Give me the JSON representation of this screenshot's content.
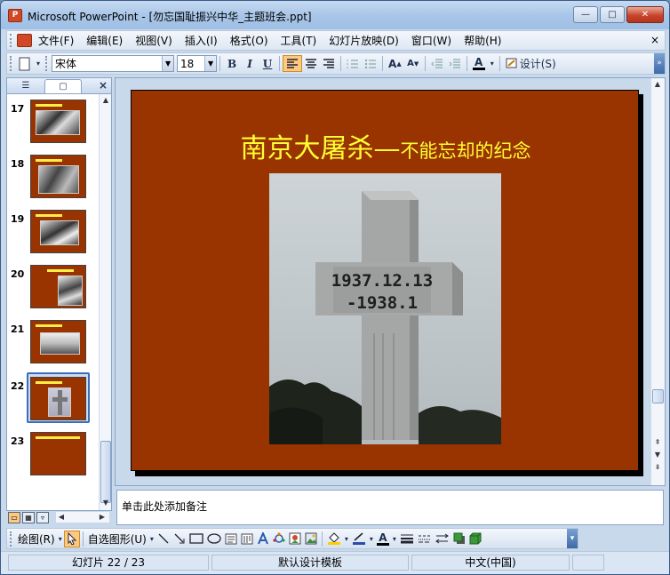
{
  "window": {
    "title": "Microsoft PowerPoint - [勿忘国耻振兴中华_主题班会.ppt]",
    "app_icon": "P",
    "minimize": "—",
    "maximize": "□",
    "close": "✕"
  },
  "menu": {
    "items": [
      "文件(F)",
      "编辑(E)",
      "视图(V)",
      "插入(I)",
      "格式(O)",
      "工具(T)",
      "幻灯片放映(D)",
      "窗口(W)",
      "帮助(H)"
    ],
    "close": "×"
  },
  "toolbar": {
    "font_name": "宋体",
    "font_size": "18",
    "bold": "B",
    "italic": "I",
    "underline": "U",
    "design_label": "设计(S)",
    "font_color_label": "A",
    "grow_font": "A",
    "shrink_font": "A",
    "more": "»"
  },
  "left_pane": {
    "tab_outline": "☰",
    "tab_slides": "▢",
    "close": "×",
    "slides": [
      {
        "num": "17",
        "title_color": "#ffee44",
        "image": "crowd-photo"
      },
      {
        "num": "18",
        "title_color": "#ffee44",
        "image": "crowd-photo"
      },
      {
        "num": "19",
        "title_color": "#ffee44",
        "image": "crowd-photo"
      },
      {
        "num": "20",
        "title_color": "#ffee44",
        "image": "crowd-photo"
      },
      {
        "num": "21",
        "title_color": "#ffee44",
        "image": "building-photo"
      },
      {
        "num": "22",
        "title_color": "#ffee44",
        "image": "monument-photo"
      },
      {
        "num": "23",
        "title_color": "#ffee44",
        "image": "none"
      }
    ]
  },
  "slide": {
    "background_color": "#993300",
    "title_main": "南京大屠杀—",
    "title_sub": "不能忘却的纪念",
    "title_color": "#ffff33",
    "monument_text_line1": "1937.12.13",
    "monument_text_line2": "-1938.1"
  },
  "notes": {
    "placeholder": "单击此处添加备注"
  },
  "drawing_toolbar": {
    "draw_label": "绘图(R)",
    "autoshape_label": "自选图形(U)",
    "font_color_label": "A"
  },
  "status": {
    "slide_info": "幻灯片 22 / 23",
    "template": "默认设计模板",
    "language": "中文(中国)"
  }
}
